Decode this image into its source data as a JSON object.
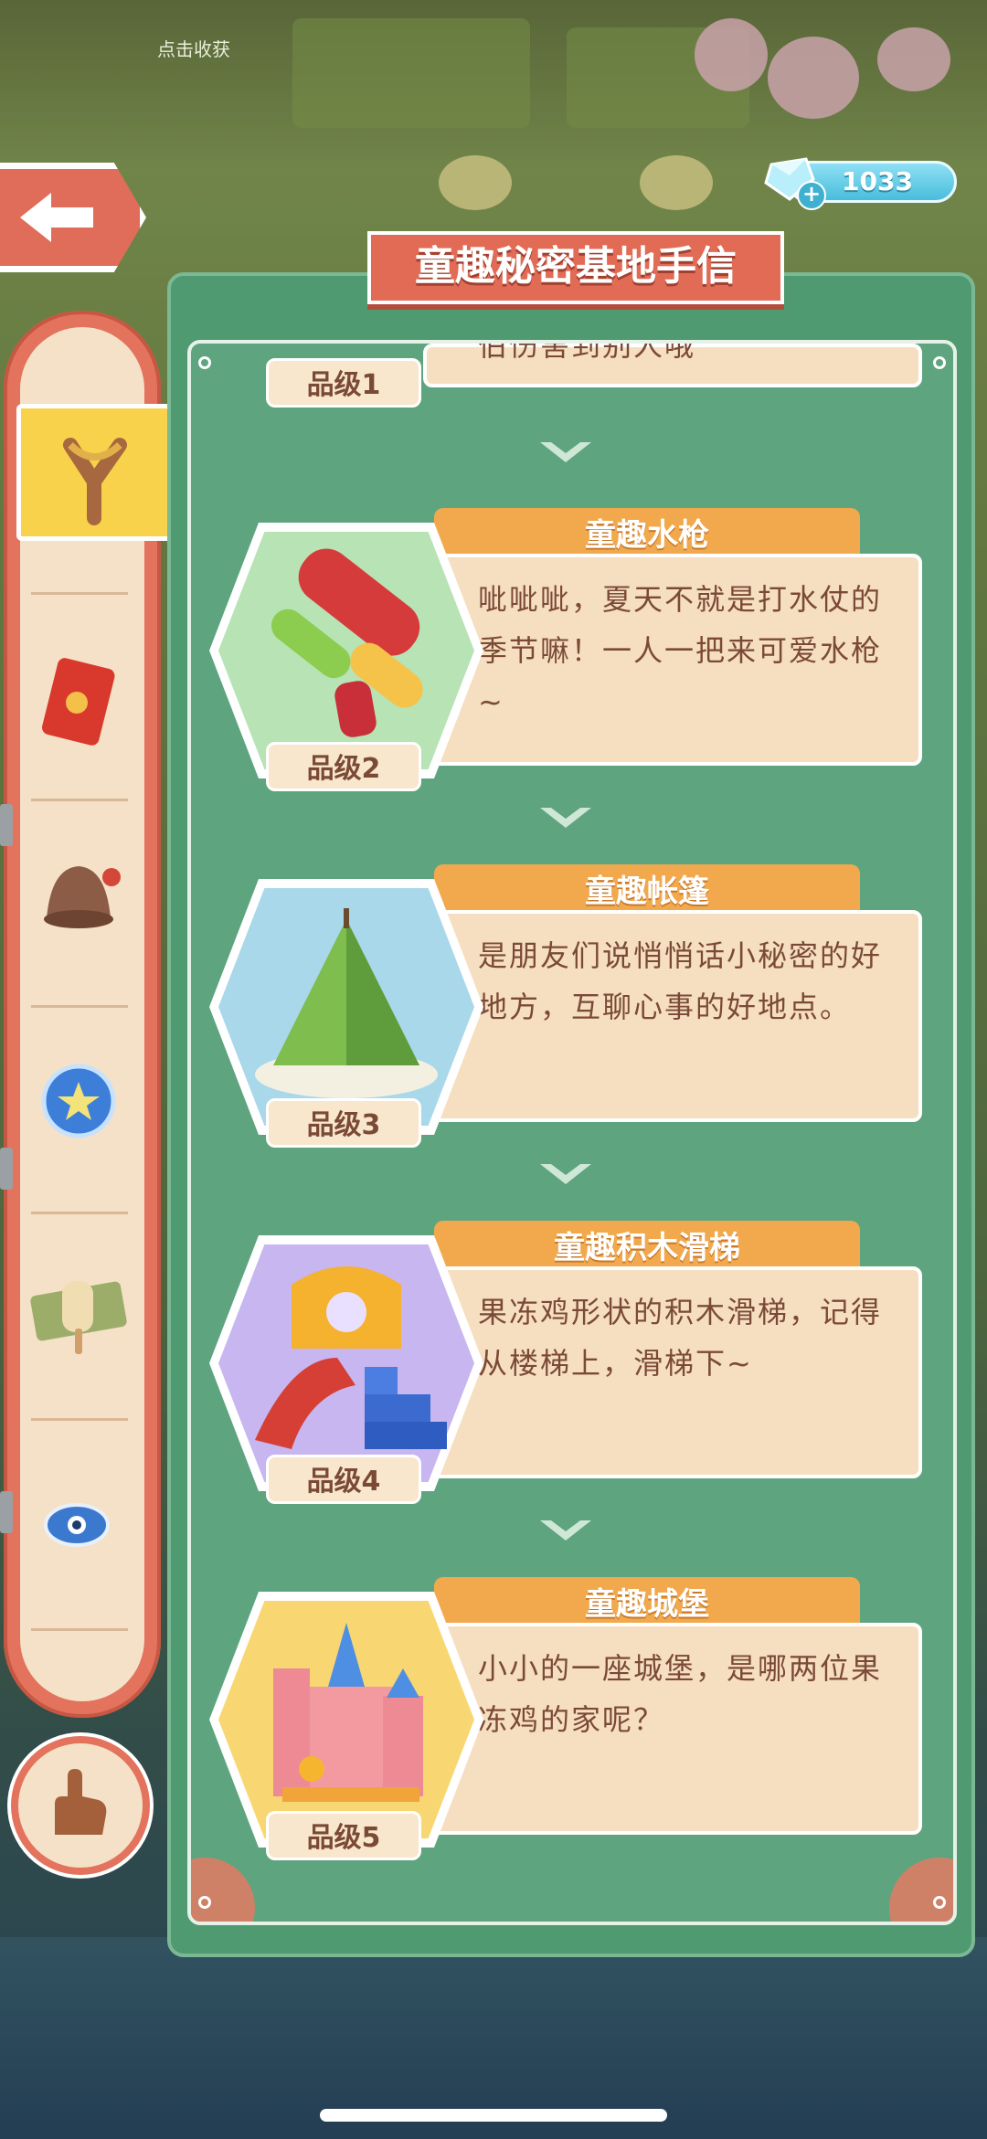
{
  "background": {
    "collect_label": "点击收获"
  },
  "header": {
    "title": "童趣秘密基地手信",
    "gem_count": "1033"
  },
  "sidebar": {
    "items": [
      {
        "name": "slingshot-icon",
        "active": true
      },
      {
        "name": "red-envelope-icon",
        "active": false
      },
      {
        "name": "bell-icon",
        "active": false
      },
      {
        "name": "star-orb-icon",
        "active": false
      },
      {
        "name": "popsicle-icon",
        "active": false
      },
      {
        "name": "eye-charm-icon",
        "active": false
      }
    ]
  },
  "list": {
    "items": [
      {
        "title": "",
        "description": "",
        "partial_text": "伯伤害到别人哦",
        "grade": "品级1"
      },
      {
        "title": "童趣水枪",
        "description": "呲呲呲，夏天不就是打水仗的季节嘛！一人一把来可爱水枪~",
        "grade": "品级2"
      },
      {
        "title": "童趣帐篷",
        "description": "是朋友们说悄悄话小秘密的好地方，互聊心事的好地点。",
        "grade": "品级3"
      },
      {
        "title": "童趣积木滑梯",
        "description": "果冻鸡形状的积木滑梯，记得从楼梯上，滑梯下~",
        "grade": "品级4"
      },
      {
        "title": "童趣城堡",
        "description": "小小的一座城堡，是哪两位果冻鸡的家呢？",
        "grade": "品级5"
      }
    ]
  },
  "colors": {
    "panel_green": "#4f9a70",
    "banner_red": "#e26b55",
    "tab_orange": "#f2a94d",
    "card_cream": "#f6dfc0",
    "text_brown": "#7b4a36",
    "hex_green": "#b7e3b5",
    "hex_blue": "#a8d8ea",
    "hex_purple": "#c7b6ef",
    "hex_yellow": "#f8d773"
  }
}
